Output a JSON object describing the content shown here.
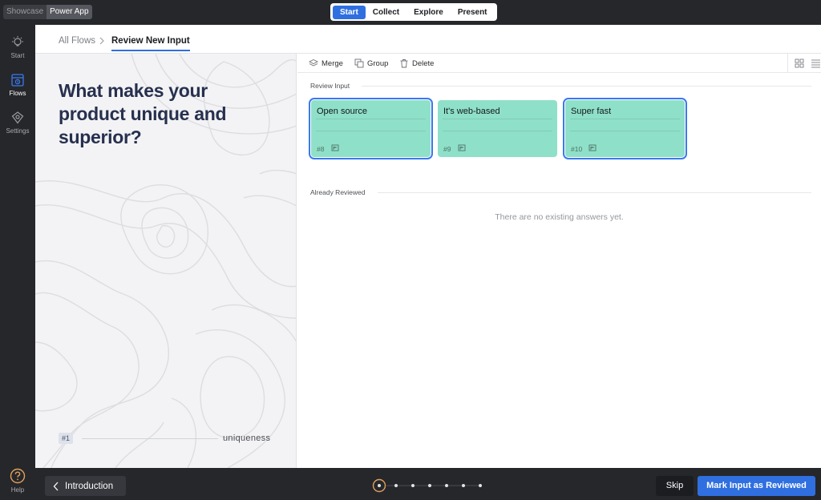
{
  "app": {
    "mode_toggle": [
      "Showcase",
      "Power App"
    ],
    "active_mode": "Power App",
    "main_tabs": [
      {
        "label": "Start",
        "active": true
      },
      {
        "label": "Collect",
        "active": false
      },
      {
        "label": "Explore",
        "active": false
      },
      {
        "label": "Present",
        "active": false
      }
    ]
  },
  "rail": {
    "items": [
      {
        "label": "Start",
        "icon": "lightbulb-icon"
      },
      {
        "label": "Flows",
        "icon": "flows-icon",
        "active": true
      },
      {
        "label": "Settings",
        "icon": "settings-icon"
      }
    ],
    "help": {
      "label": "Help",
      "icon": "help-icon"
    }
  },
  "breadcrumb": {
    "root": "All Flows",
    "current": "Review New Input"
  },
  "question": {
    "text": "What makes your product unique and superior?",
    "number": "#1",
    "tag": "uniqueness"
  },
  "toolbar": {
    "merge_label": "Merge",
    "group_label": "Group",
    "delete_label": "Delete"
  },
  "review": {
    "section_title": "Review Input",
    "cards": [
      {
        "title": "Open source",
        "number": "#8",
        "selected": true
      },
      {
        "title": "It's web-based",
        "number": "#9",
        "selected": false
      },
      {
        "title": "Super fast",
        "number": "#10",
        "selected": true
      }
    ],
    "reviewed_title": "Already Reviewed",
    "empty_message": "There are no existing answers yet."
  },
  "footer": {
    "back_label": "Introduction",
    "skip_label": "Skip",
    "mark_label": "Mark Input as Reviewed",
    "progress_steps": 7,
    "progress_current": 1
  },
  "colors": {
    "accent": "#2f6fe0",
    "card": "#8fe0c8",
    "chrome": "#25272b",
    "progress_ring": "#e2a05a"
  }
}
